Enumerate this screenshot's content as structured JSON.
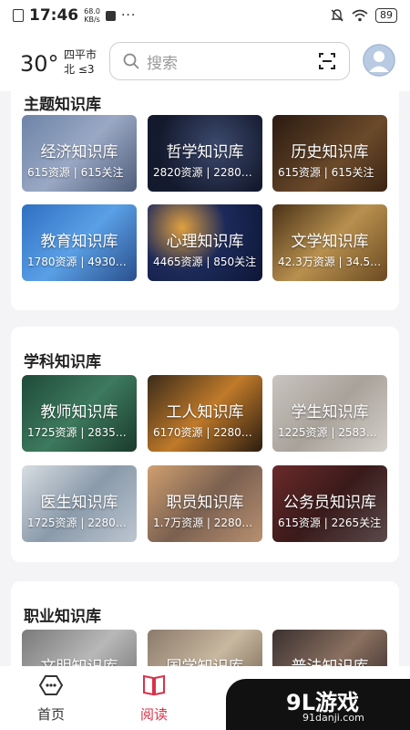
{
  "status_bar": {
    "time": "17:46",
    "net_speed_value": "68.0",
    "net_speed_unit": "KB/s",
    "dots": "···",
    "battery": "89"
  },
  "header": {
    "temperature": "30°",
    "city": "四平市",
    "wind": "北 ≤3",
    "search_placeholder": "搜索"
  },
  "sections": [
    {
      "title": "主题知识库",
      "cards": [
        {
          "title": "经济知识库",
          "meta": "615资源 | 615关注",
          "bg": "linear-gradient(135deg,#6d84a8,#9aa8c4 50%,#4e5d7a)"
        },
        {
          "title": "哲学知识库",
          "meta": "2820资源 | 2280…",
          "bg": "radial-gradient(circle at 60% 40%,#3d4a6e,#141a2e 70%)"
        },
        {
          "title": "历史知识库",
          "meta": "615资源 | 615关注",
          "bg": "linear-gradient(135deg,#2b1a12,#6b4a2a 60%,#3a2414)"
        },
        {
          "title": "教育知识库",
          "meta": "1780资源 | 4930…",
          "bg": "linear-gradient(135deg,#2f6fc2,#5aa0e6 50%,#2a4f8c)"
        },
        {
          "title": "心理知识库",
          "meta": "4465资源 | 850关注",
          "bg": "radial-gradient(circle at 30% 30%,#e0a040 0,#1c2a5a 45%,#0e1636)"
        },
        {
          "title": "文学知识库",
          "meta": "42.3万资源 | 34.5…",
          "bg": "linear-gradient(135deg,#4a3218,#b8904e 50%,#6a4a22)"
        }
      ]
    },
    {
      "title": "学科知识库",
      "cards": [
        {
          "title": "教师知识库",
          "meta": "1725资源 | 2835…",
          "bg": "linear-gradient(135deg,#1f4a3a,#3d7a5e 50%,#1a3a2c)"
        },
        {
          "title": "工人知识库",
          "meta": "6170资源 | 2280…",
          "bg": "linear-gradient(135deg,#3a2a1a,#c07a2a 50%,#2a1c10)"
        },
        {
          "title": "学生知识库",
          "meta": "1225资源 | 2583…",
          "bg": "linear-gradient(135deg,#c8c4be,#a8a29a 50%,#d4d0ca)"
        },
        {
          "title": "医生知识库",
          "meta": "1725资源 | 2280…",
          "bg": "linear-gradient(135deg,#d8dde2,#8a9aaa 50%,#bcc6d0)"
        },
        {
          "title": "职员知识库",
          "meta": "1.7万资源 | 2280…",
          "bg": "linear-gradient(135deg,#d0a070,#7a6050 50%,#b89070)"
        },
        {
          "title": "公务员知识库",
          "meta": "615资源 | 2265关注",
          "bg": "linear-gradient(135deg,#6a2a2a,#3a1a1a 50%,#5a4a4a)"
        }
      ]
    },
    {
      "title": "职业知识库",
      "cards": [
        {
          "title": "文明知识库",
          "meta": "",
          "bg": "linear-gradient(135deg,#7a7a7a,#b8b8b8 50%,#6a6a6a)"
        },
        {
          "title": "国学知识库",
          "meta": "",
          "bg": "linear-gradient(135deg,#8a7a6a,#c8b8a0 50%,#6a5a48)"
        },
        {
          "title": "普法知识库",
          "meta": "",
          "bg": "linear-gradient(135deg,#3a3030,#8a7060 50%,#2a2222)"
        }
      ]
    }
  ],
  "bottom_nav": [
    {
      "label": "首页",
      "icon": "home-icon",
      "active": false
    },
    {
      "label": "阅读",
      "icon": "book-icon",
      "active": true
    }
  ],
  "watermark": {
    "logo": "9L游戏",
    "url": "91danji.com"
  },
  "colors": {
    "accent": "#d9324a",
    "background": "#f4f4f6"
  }
}
